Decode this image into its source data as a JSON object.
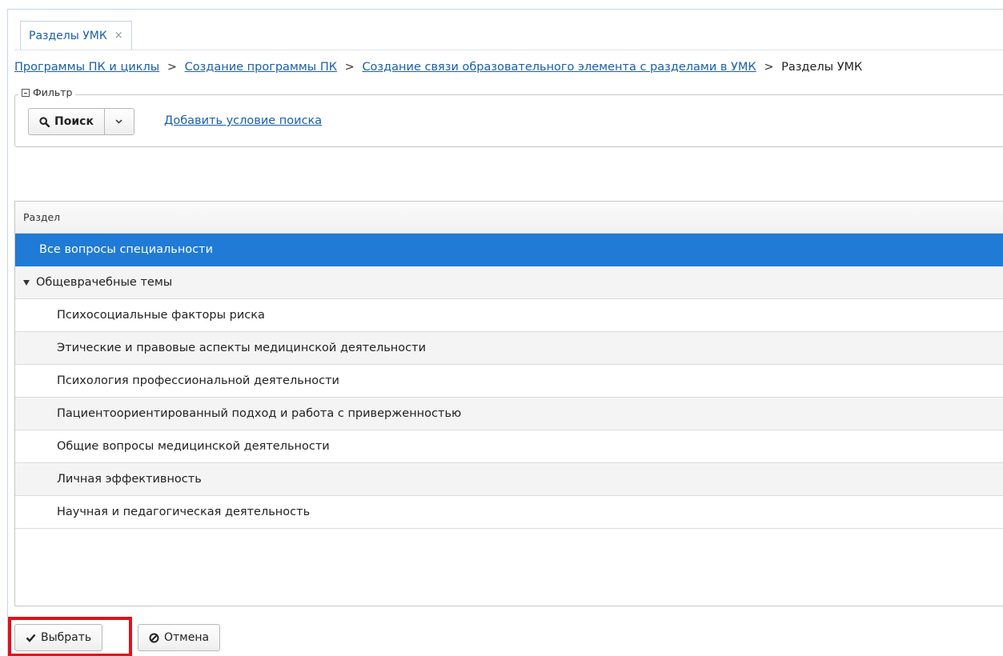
{
  "tab": {
    "label": "Разделы УМК",
    "close_glyph": "×"
  },
  "breadcrumb": {
    "links": [
      "Программы ПК и циклы",
      "Создание программы ПК",
      "Создание связи образовательного элемента с разделами в УМК"
    ],
    "separator": ">",
    "current": "Разделы УМК"
  },
  "filter": {
    "legend": "Фильтр",
    "search_label": "Поиск",
    "add_condition_label": "Добавить условие поиска"
  },
  "grid": {
    "column_header": "Раздел",
    "selected_row": "Все вопросы специальности",
    "group_row": "Общеврачебные темы",
    "child_rows": [
      "Психосоциальные факторы риска",
      "Этические и правовые аспекты медицинской деятельности",
      "Психология профессиональной деятельности",
      "Пациентоориентированный подход и работа с приверженностью",
      "Общие вопросы медицинской деятельности",
      "Личная эффективность",
      "Научная и педагогическая деятельность"
    ]
  },
  "buttons": {
    "select_label": "Выбрать",
    "cancel_label": "Отмена"
  },
  "colors": {
    "selected_row": "#1f7bd6",
    "link": "#1a5fa8",
    "highlight": "#e3101a"
  },
  "icons": [
    "close-icon",
    "collapse-icon",
    "search-icon",
    "chevron-down-icon",
    "caret-down-icon",
    "check-icon",
    "cancel-icon"
  ]
}
